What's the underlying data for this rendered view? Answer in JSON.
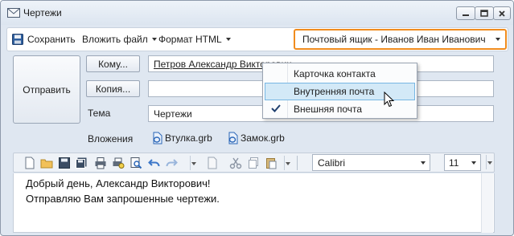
{
  "window": {
    "title": "Чертежи"
  },
  "toolbar": {
    "save_label": "Сохранить",
    "attach_label": "Вложить файл",
    "format_label": "Формат HTML",
    "mailbox_label": "Почтовый ящик - Иванов Иван Иванович"
  },
  "compose": {
    "send_label": "Отправить",
    "to_button_label": "Кому...",
    "to_value": "Петров Александр Викторович",
    "cc_button_label": "Копия...",
    "cc_value": "",
    "subject_label": "Тема",
    "subject_value": "Чертежи",
    "attachments_label": "Вложения",
    "attachments": [
      {
        "name": "Втулка.grb"
      },
      {
        "name": "Замок.grb"
      }
    ]
  },
  "dropdown": {
    "items": [
      {
        "label": "Карточка контакта",
        "checked": false,
        "hovered": false
      },
      {
        "label": "Внутренняя почта",
        "checked": false,
        "hovered": true
      },
      {
        "label": "Внешняя почта",
        "checked": true,
        "hovered": false
      }
    ]
  },
  "format_bar": {
    "font": "Calibri",
    "size": "11"
  },
  "body": {
    "lines": [
      "Добрый день, Александр Викторович!",
      "Отправляю Вам запрошенные чертежи."
    ]
  },
  "colors": {
    "highlight_border": "#f08c1e",
    "menu_hover": "#d3e9f7",
    "window_bg": "#dfe7f1"
  }
}
